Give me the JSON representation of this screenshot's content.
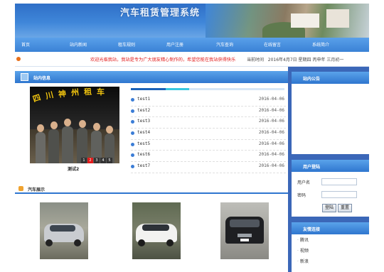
{
  "header": {
    "title": "汽车租赁管理系统"
  },
  "nav": [
    "首页",
    "站内新闻",
    "租车规则",
    "用户注册",
    "汽车查询",
    "在线留言",
    "系统简介"
  ],
  "notice": {
    "message": "欢迎光临我站，我站是专为广大朋友精心制作的，希望您能在我站获得快乐",
    "time_label": "当前时间",
    "date": "2016年4月7日 星期四 丙申年 三月初一"
  },
  "news_section": {
    "title": "站内信息",
    "caption": "测试2",
    "pager": [
      "1",
      "2",
      "3",
      "4",
      "5"
    ],
    "progress": 0.38,
    "items": [
      {
        "title": "test1",
        "date": "2016-04-06"
      },
      {
        "title": "test2",
        "date": "2016-04-06"
      },
      {
        "title": "test3",
        "date": "2016-04-06"
      },
      {
        "title": "test4",
        "date": "2016-04-06"
      },
      {
        "title": "test5",
        "date": "2016-04-06"
      },
      {
        "title": "test6",
        "date": "2016-04-06"
      },
      {
        "title": "test7",
        "date": "2016-04-06"
      }
    ]
  },
  "cars_section": {
    "title": "汽车展示"
  },
  "sidebar": {
    "announce_title": "站内公告",
    "login": {
      "title": "用户登陆",
      "username_label": "用户名",
      "password_label": "密码",
      "login_button": "登陆",
      "reset_button": "重置"
    },
    "links": {
      "title": "友情连接",
      "items": [
        "腾讯",
        "视频",
        "新浪"
      ]
    }
  },
  "colors": {
    "accent": "#2f76cf",
    "notice": "#e11a1a",
    "frame": "#3b67b8"
  }
}
